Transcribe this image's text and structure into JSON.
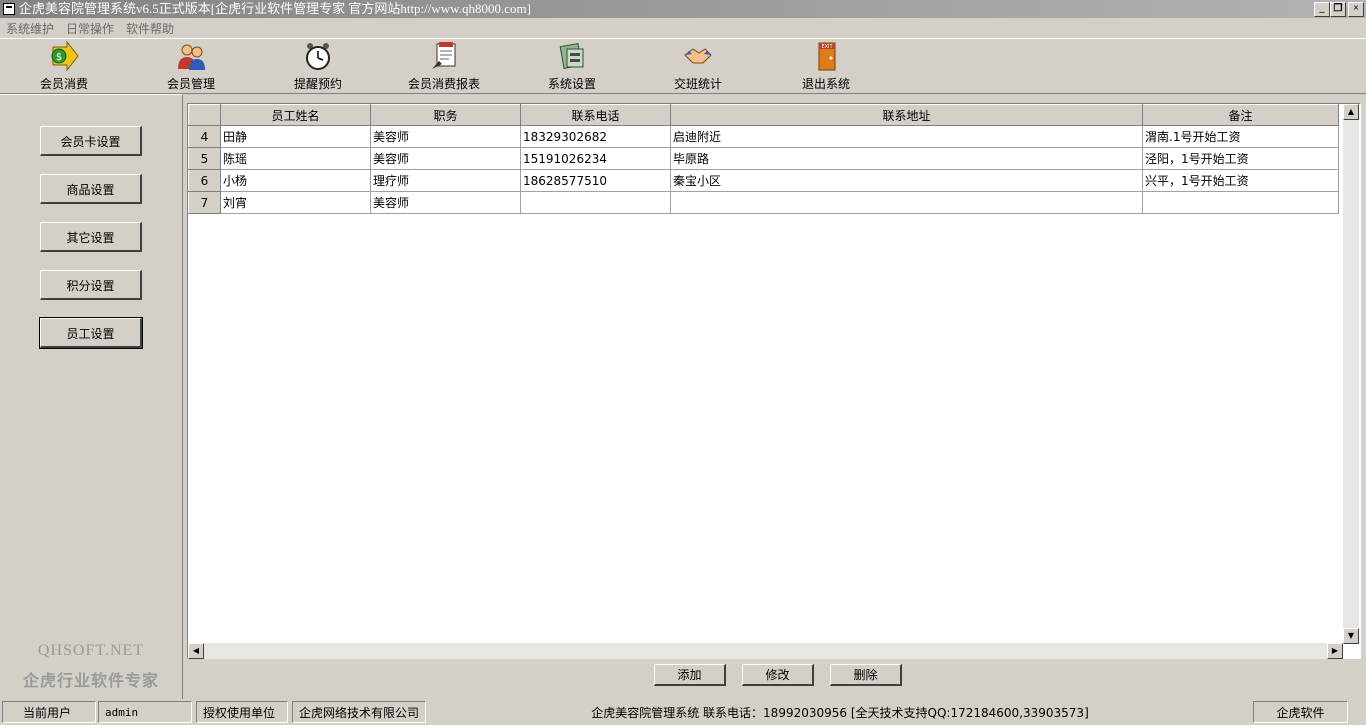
{
  "window": {
    "title": "企虎美容院管理系统v6.5正式版本[企虎行业软件管理专家 官方网站http://www.qh8000.com]",
    "controls": [
      "_",
      "❐",
      "×"
    ]
  },
  "menu": [
    "系统维护",
    "日常操作",
    "软件帮助"
  ],
  "toolbar": [
    {
      "label": "会员消费",
      "icon": "dollar-arrow-icon"
    },
    {
      "label": "会员管理",
      "icon": "users-icon"
    },
    {
      "label": "提醒预约",
      "icon": "alarm-clock-icon"
    },
    {
      "label": "会员消费报表",
      "icon": "report-icon"
    },
    {
      "label": "系统设置",
      "icon": "settings-icon"
    },
    {
      "label": "交班统计",
      "icon": "handshake-icon"
    },
    {
      "label": "退出系统",
      "icon": "exit-door-icon"
    }
  ],
  "sidebar": {
    "buttons": [
      "会员卡设置",
      "商品设置",
      "其它设置",
      "积分设置",
      "员工设置"
    ],
    "active": "员工设置",
    "brand_line1": "QHSOFT.NET",
    "brand_line2": "企虎行业软件专家"
  },
  "grid": {
    "columns": [
      "员工姓名",
      "职务",
      "联系电话",
      "联系地址",
      "备注"
    ],
    "rows": [
      {
        "no": "4",
        "cells": [
          "田静",
          "美容师",
          "18329302682",
          "启迪附近",
          "渭南.1号开始工资"
        ]
      },
      {
        "no": "5",
        "cells": [
          "陈瑶",
          "美容师",
          "15191026234",
          "毕原路",
          "泾阳，1号开始工资"
        ]
      },
      {
        "no": "6",
        "cells": [
          "小杨",
          "理疗师",
          "18628577510",
          "秦宝小区",
          "兴平，1号开始工资"
        ]
      },
      {
        "no": "7",
        "cells": [
          "刘宵",
          "美容师",
          "",
          "",
          ""
        ]
      }
    ]
  },
  "actions": {
    "add": "添加",
    "edit": "修改",
    "delete": "删除"
  },
  "statusbar": {
    "user_label": "当前用户",
    "user_value": "admin",
    "licensee_label": "授权使用单位",
    "licensee_value": "企虎网络技术有限公司",
    "info": "企虎美容院管理系统   联系电话：18992030956  [全天技术支持QQ:172184600,33903573]",
    "right": "企虎软件"
  }
}
